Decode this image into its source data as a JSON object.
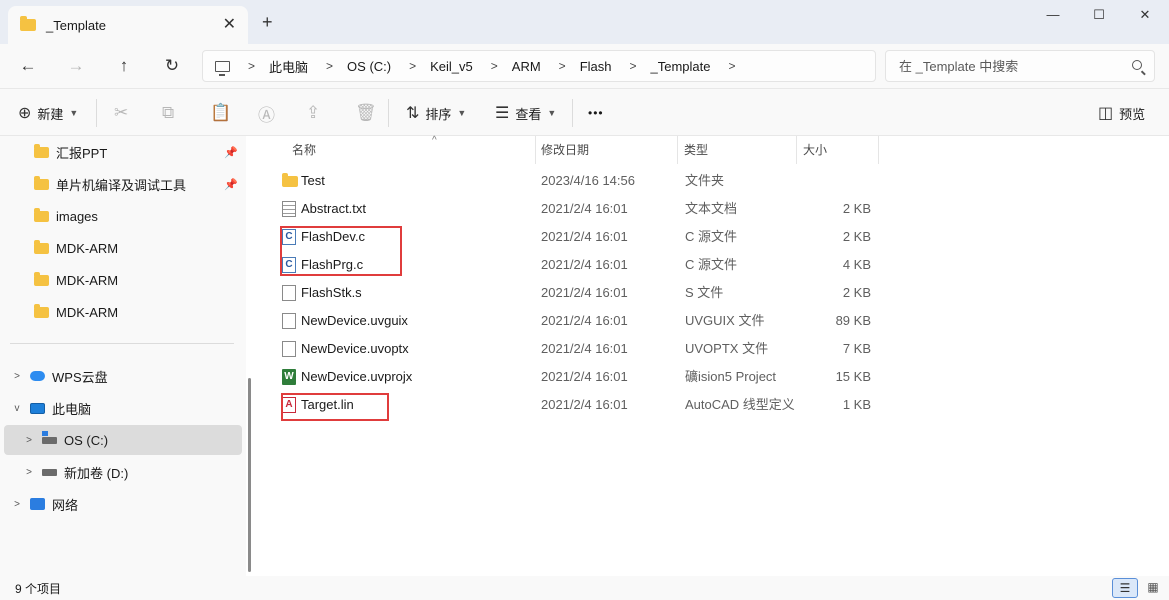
{
  "tab": {
    "title": "_Template",
    "close_icon": "✕",
    "add_icon": "+"
  },
  "window": {
    "minimize": "—",
    "maximize": "☐",
    "close": "✕"
  },
  "nav": {
    "back": "←",
    "forward": "→",
    "up": "↑",
    "refresh": "↻"
  },
  "breadcrumb": [
    "此电脑",
    "OS (C:)",
    "Keil_v5",
    "ARM",
    "Flash",
    "_Template"
  ],
  "search": {
    "placeholder": "在 _Template 中搜索"
  },
  "toolbar": {
    "new_label": "新建",
    "sort_label": "排序",
    "view_label": "查看",
    "more": "•••",
    "preview_label": "预览"
  },
  "sidebar": {
    "quick_items": [
      {
        "label": "汇报PPT",
        "pinned": true
      },
      {
        "label": "单片机编译及调试工具",
        "pinned": true
      },
      {
        "label": "images"
      },
      {
        "label": "MDK-ARM"
      },
      {
        "label": "MDK-ARM"
      },
      {
        "label": "MDK-ARM"
      }
    ],
    "tree": [
      {
        "label": "WPS云盘"
      },
      {
        "label": "此电脑"
      },
      {
        "label": "OS (C:)",
        "selected": true
      },
      {
        "label": "新加卷 (D:)"
      },
      {
        "label": "网络"
      }
    ]
  },
  "columns": {
    "name": "名称",
    "date": "修改日期",
    "type": "类型",
    "size": "大小"
  },
  "files": [
    {
      "name": "Test",
      "date": "2023/4/16 14:56",
      "type": "文件夹",
      "size": "",
      "icon": "folder-icon"
    },
    {
      "name": "Abstract.txt",
      "date": "2021/2/4 16:01",
      "type": "文本文档",
      "size": "2 KB",
      "icon": "text-file-icon"
    },
    {
      "name": "FlashDev.c",
      "date": "2021/2/4 16:01",
      "type": "C 源文件",
      "size": "2 KB",
      "icon": "c-source-icon"
    },
    {
      "name": "FlashPrg.c",
      "date": "2021/2/4 16:01",
      "type": "C 源文件",
      "size": "4 KB",
      "icon": "c-source-icon"
    },
    {
      "name": "FlashStk.s",
      "date": "2021/2/4 16:01",
      "type": "S 文件",
      "size": "2 KB",
      "icon": "file-icon"
    },
    {
      "name": "NewDevice.uvguix",
      "date": "2021/2/4 16:01",
      "type": "UVGUIX 文件",
      "size": "89 KB",
      "icon": "file-icon"
    },
    {
      "name": "NewDevice.uvoptx",
      "date": "2021/2/4 16:01",
      "type": "UVOPTX 文件",
      "size": "7 KB",
      "icon": "file-icon"
    },
    {
      "name": "NewDevice.uvprojx",
      "date": "2021/2/4 16:01",
      "type": "礦ision5 Project",
      "size": "15 KB",
      "icon": "uvision-icon"
    },
    {
      "name": "Target.lin",
      "date": "2021/2/4 16:01",
      "type": "AutoCAD 线型定义",
      "size": "1 KB",
      "icon": "autocad-icon"
    }
  ],
  "status": {
    "count": "9 个项目"
  },
  "colors": {
    "highlight": "#e03c3c",
    "folder": "#f5c242",
    "selected": "#dcdcdc"
  }
}
